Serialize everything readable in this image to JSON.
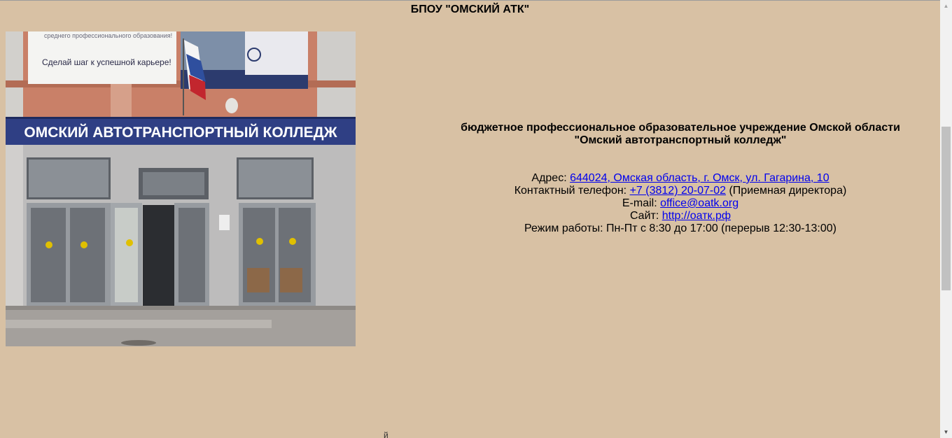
{
  "header": {
    "title": "БПОУ \"ОМСКИЙ АТК\""
  },
  "photo": {
    "icon": "building-photo",
    "sign_text": "ОМСКИЙ АВТОТРАНСПОРТНЫЙ КОЛЛЕДЖ",
    "banner_text": "Сделай шаг к успешной карьере!",
    "banner_top_text": "среднего профессионального образования!"
  },
  "info": {
    "org_name_line1": "бюджетное профессиональное образовательное учреждение Омской области",
    "org_name_line2": "\"Омский автотранспортный колледж\"",
    "address_label": "Адрес: ",
    "address_value": "644024, Омская область, г. Омск, ул. Гагарина, 10",
    "phone_label": "Контактный телефон: ",
    "phone_value": "+7 (3812) 20-07-02",
    "phone_note": " (Приемная директора)",
    "email_label": "E-mail: ",
    "email_value": "office@oatk.org",
    "site_label": "Сайт: ",
    "site_value": "http://оатк.рф",
    "hours": "Режим работы: Пн-Пт с 8:30 до 17:00 (перерыв 12:30-13:00)"
  },
  "footer": {
    "glyph": "й"
  },
  "scrollbar": {
    "up_icon": "chevron-up-icon",
    "down_icon": "chevron-down-icon"
  }
}
